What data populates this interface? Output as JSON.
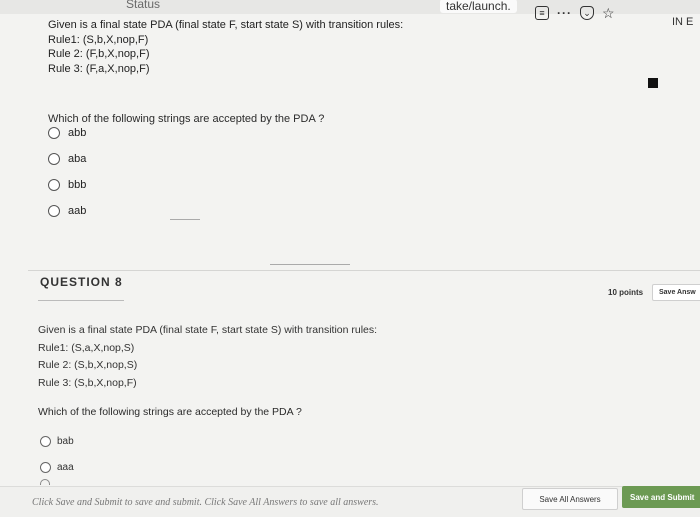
{
  "browser": {
    "status_label": "Status",
    "url_fragment": "take/launch.",
    "icons": [
      "reader-icon",
      "more-icon",
      "pocket-icon",
      "bookmark-star-icon"
    ],
    "extension_label": "IN E"
  },
  "question7": {
    "lines": [
      "Given is a final state PDA (final state F, start state S) with transition rules:",
      "Rule1: (S,b,X,nop,F)",
      "Rule 2: (F,b,X,nop,F)",
      "Rule 3: (F,a,X,nop,F)"
    ],
    "prompt": "Which of the following strings are accepted by the PDA ?",
    "options": [
      "abb",
      "aba",
      "bbb",
      "aab"
    ]
  },
  "question8": {
    "title": "QUESTION 8",
    "points": "10 points",
    "save_answer_label": "Save Answ",
    "lines": [
      "Given is a final state PDA (final state F, start state S) with transition rules:",
      "Rule1: (S,a,X,nop,S)",
      "Rule 2: (S,b,X,nop,S)",
      "Rule 3: (S,b,X,nop,F)"
    ],
    "prompt": "Which of the following strings are accepted by the PDA ?",
    "options": [
      "bab",
      "aaa"
    ]
  },
  "footer": {
    "instruction": "Click Save and Submit to save and submit. Click Save All Answers to save all answers.",
    "save_all_label": "Save All Answers",
    "save_submit_label": "Save and Submit",
    "submit_color": "#6c9a53"
  }
}
